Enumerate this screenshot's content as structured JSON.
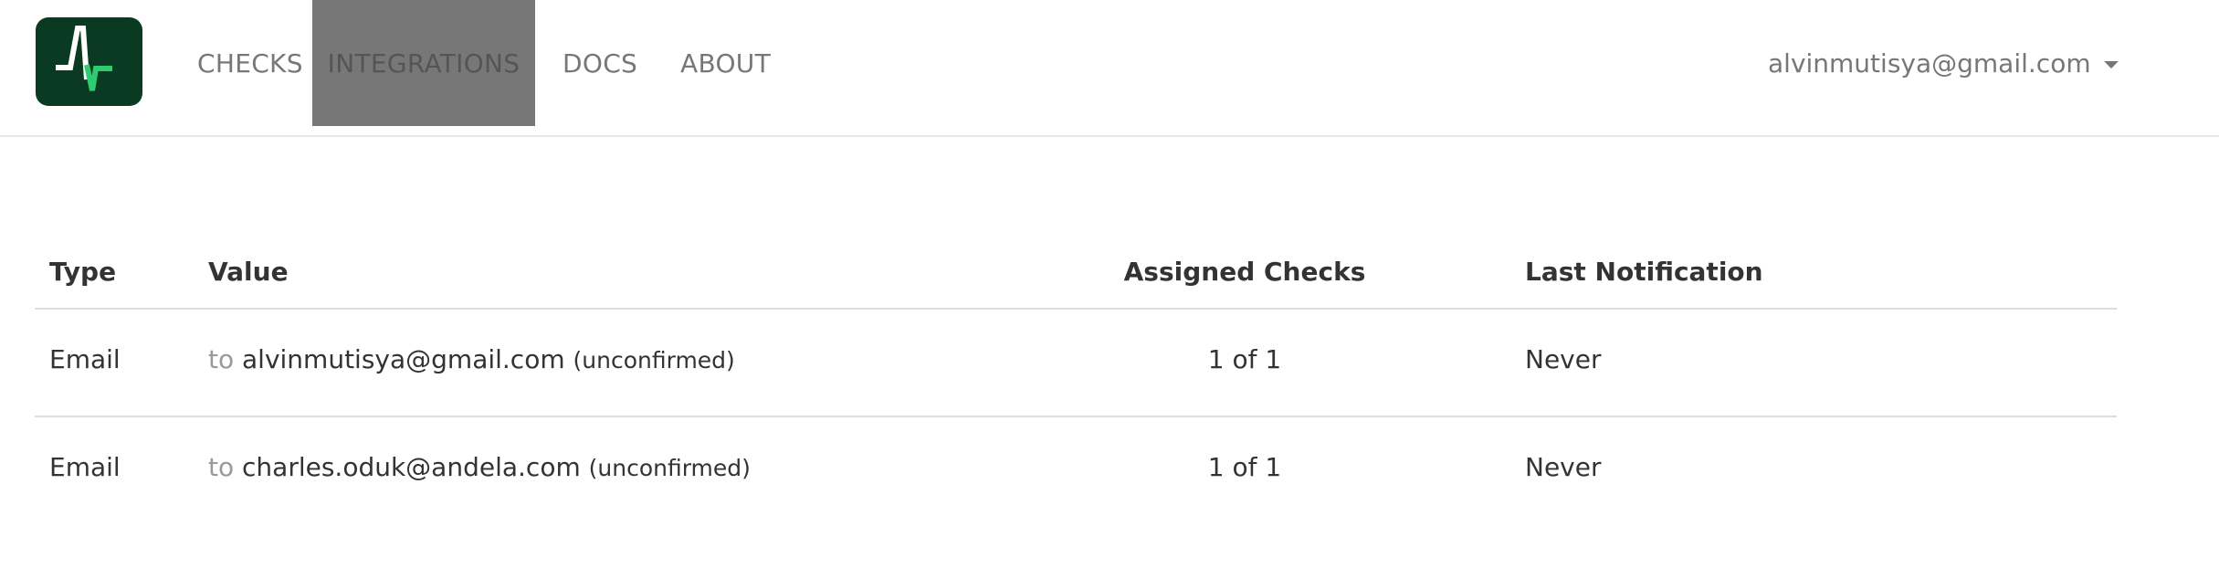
{
  "navbar": {
    "logo_icon": "heartbeat-icon",
    "items": [
      {
        "label": "CHECKS",
        "active": false
      },
      {
        "label": "INTEGRATIONS",
        "active": true
      },
      {
        "label": "DOCS",
        "active": false
      },
      {
        "label": "ABOUT",
        "active": false
      }
    ],
    "user_email": "alvinmutisya@gmail.com",
    "user_menu_icon": "caret-down-icon"
  },
  "table": {
    "headers": {
      "type": "Type",
      "value": "Value",
      "assigned": "Assigned Checks",
      "last": "Last Notification"
    },
    "rows": [
      {
        "type": "Email",
        "to": "to",
        "value": "alvinmutisya@gmail.com",
        "status": "(unconfirmed)",
        "assigned": "1 of 1",
        "last": "Never"
      },
      {
        "type": "Email",
        "to": "to",
        "value": "charles.oduk@andela.com",
        "status": "(unconfirmed)",
        "assigned": "1 of 1",
        "last": "Never"
      }
    ]
  },
  "colors": {
    "logo_bg": "#0b3a22",
    "logo_accent": "#2ecc71",
    "active_nav_bg": "#777777"
  }
}
